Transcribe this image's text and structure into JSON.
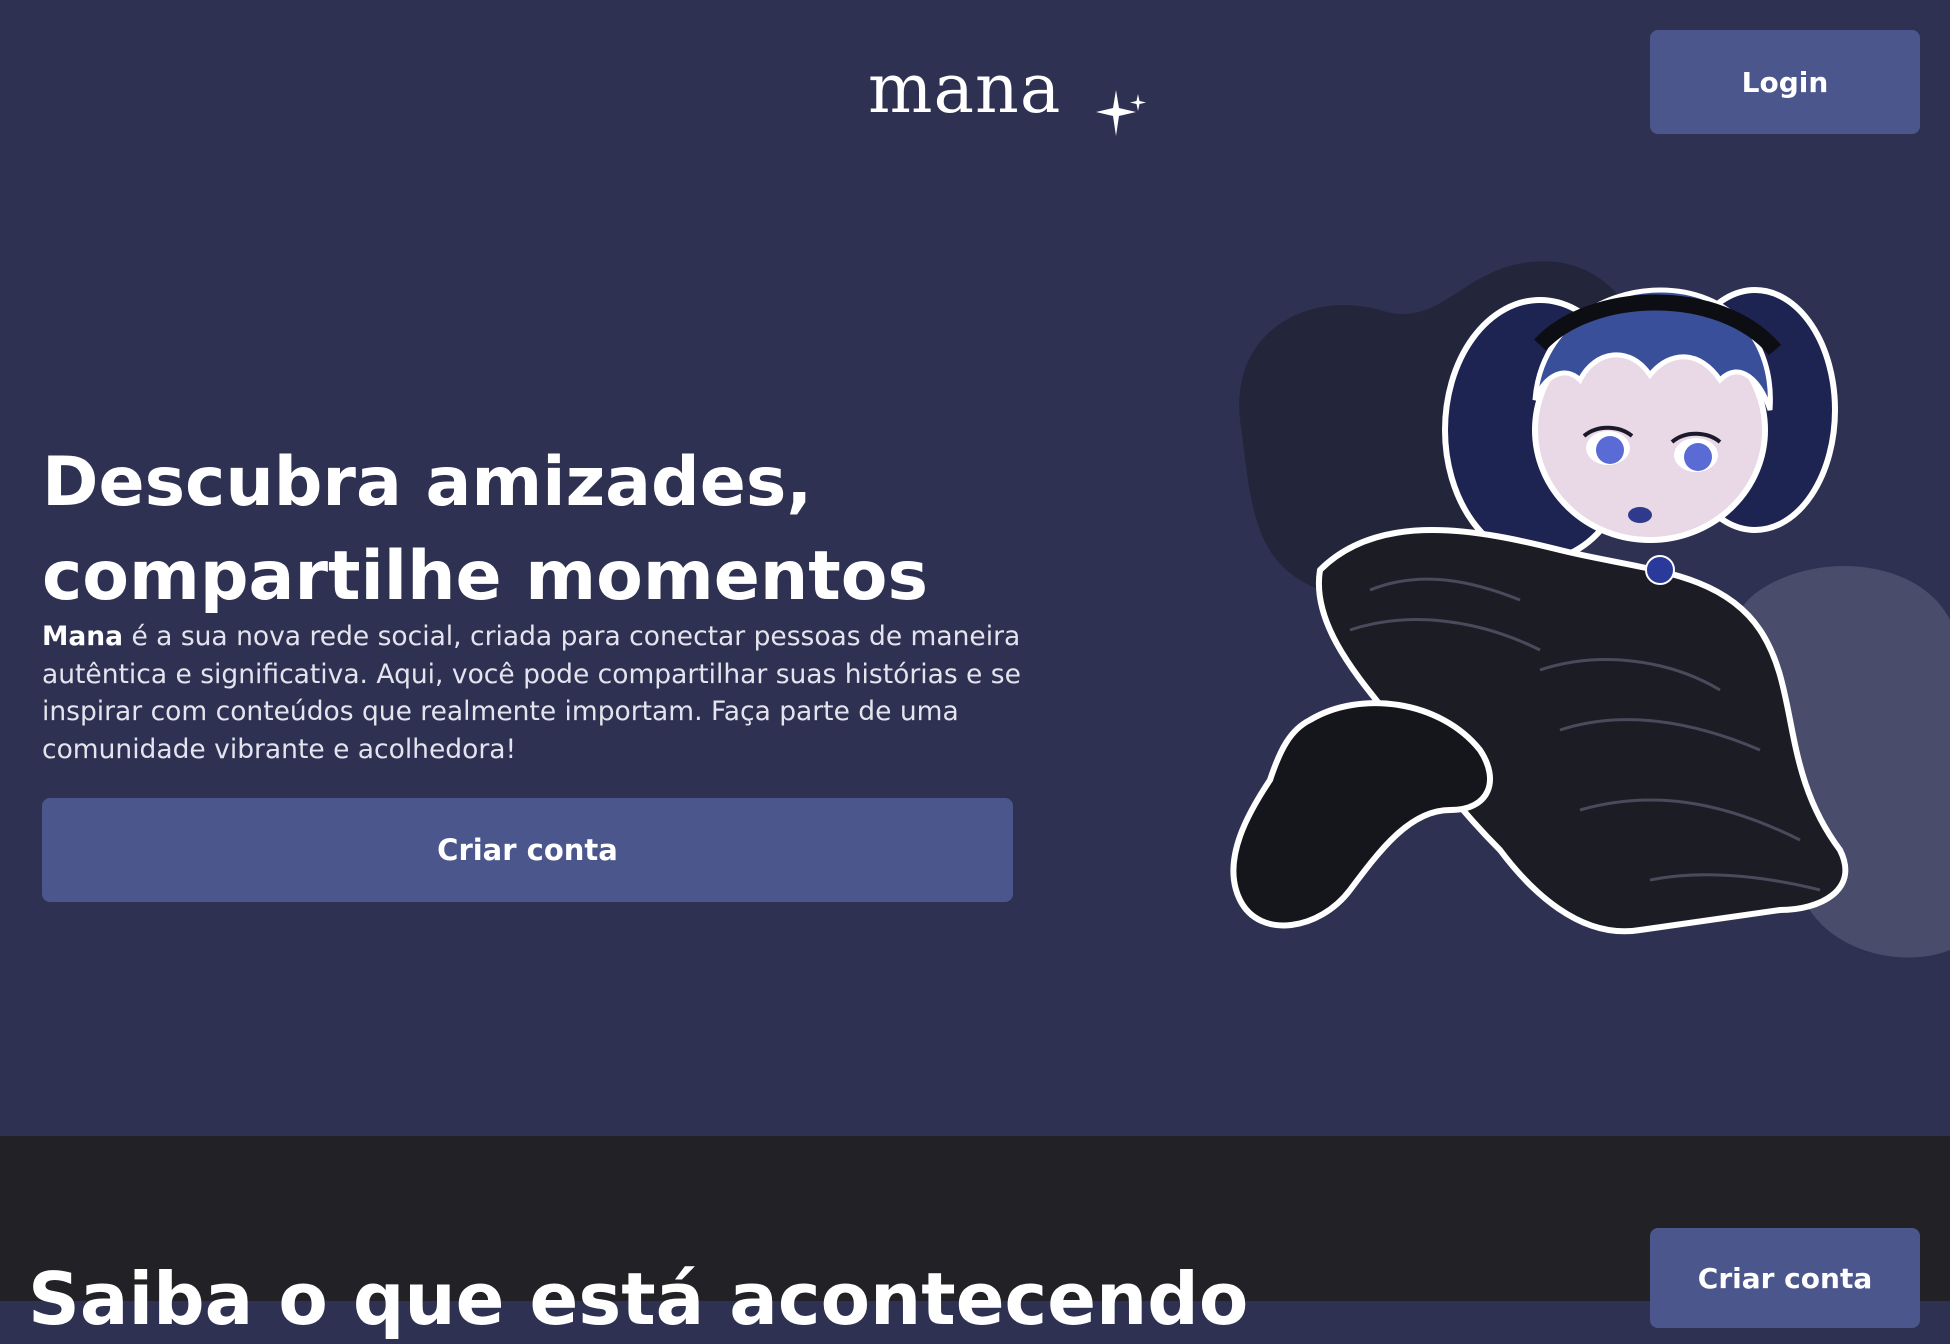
{
  "header": {
    "logo_text": "mana",
    "login_label": "Login"
  },
  "hero": {
    "title_line1": "Descubra amizades,",
    "title_line2": "compartilhe momentos",
    "description_brand": "Mana",
    "description_text": " é a sua nova rede social, criada para conectar pessoas de maneira autêntica e significativa. Aqui, você pode compartilhar suas histórias e se inspirar com conteúdos que realmente importam. Faça parte de uma comunidade vibrante e acolhedora!",
    "cta_label": "Criar conta"
  },
  "section2": {
    "title": "Saiba o que está acontecendo",
    "cta_label": "Criar conta"
  },
  "colors": {
    "hero_background": "#2f3152",
    "button": "#4b578c",
    "bottom_background": "#222126",
    "blob_dark": "#23253b",
    "blob_light": "#4a4c6c"
  },
  "icons": {
    "logo_sparkle": "sparkle-icon",
    "illustration": "gothic-lolita-character"
  }
}
